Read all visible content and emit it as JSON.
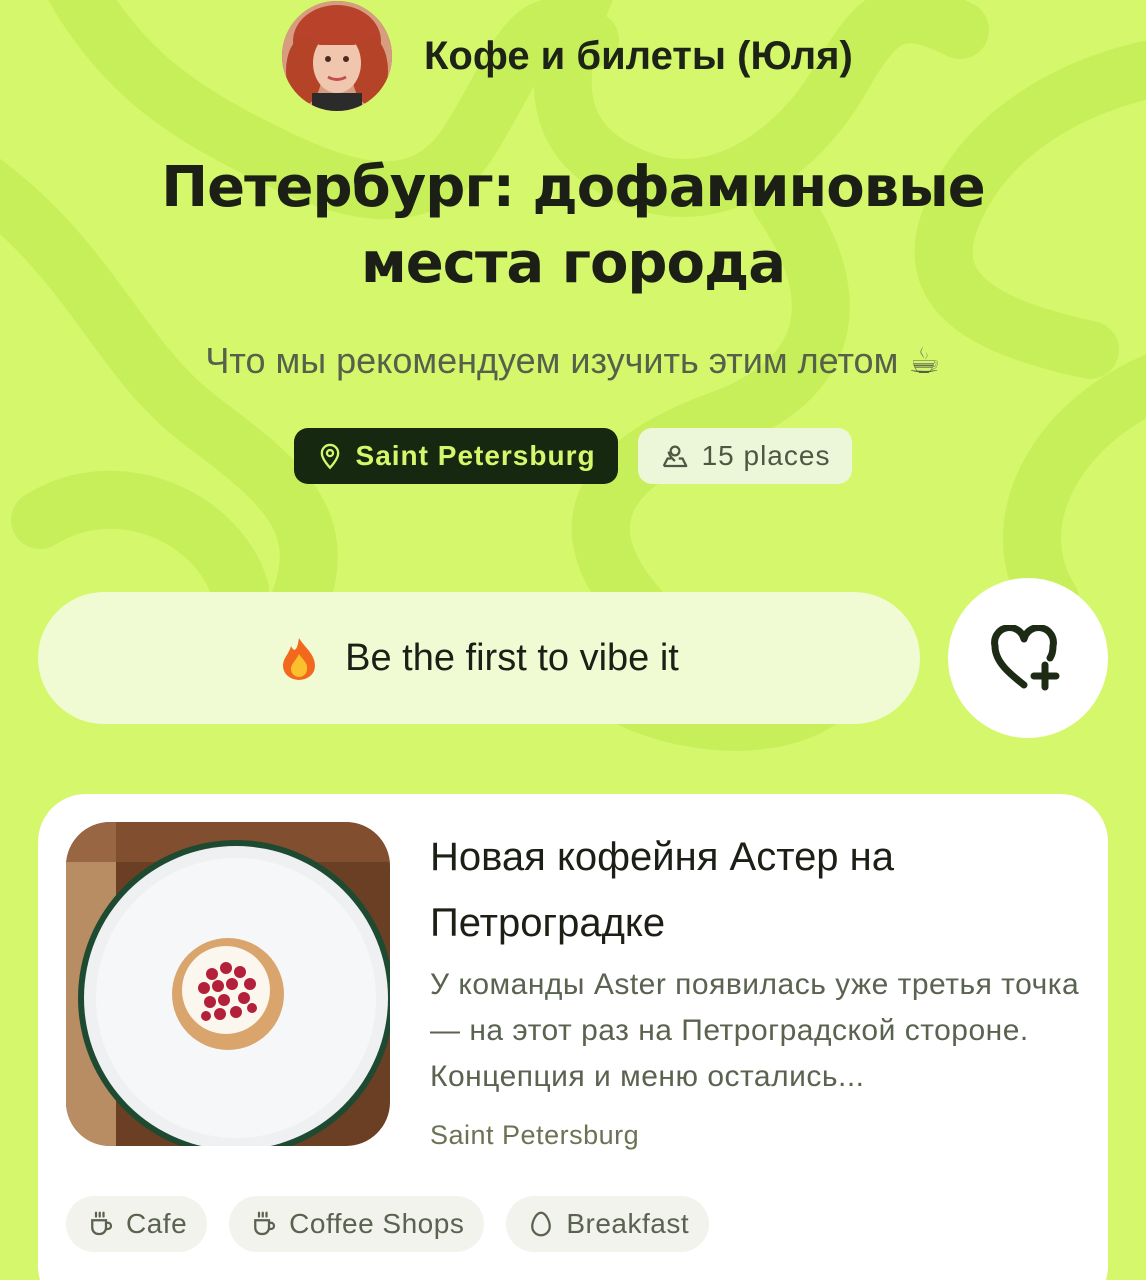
{
  "author": {
    "name": "Кофе и билеты (Юля)",
    "avatar_icon": "avatar-photo"
  },
  "page": {
    "title_line1": "Петербург: дофаминовые",
    "title_line2": "места города",
    "subtitle": "Что мы рекомендуем изучить этим летом ☕"
  },
  "chips": {
    "city": "Saint Petersburg",
    "city_icon": "location-pin-icon",
    "places": "15 places",
    "places_icon": "map-person-icon"
  },
  "vibe": {
    "label": "Be the first to vibe it",
    "emoji": "fire-icon",
    "fav_icon": "heart-plus-icon"
  },
  "card": {
    "title": "Новая кофейня Астер на Петроградке",
    "description": "У команды Aster появилась уже третья точка — на этот раз на Петроградской стороне. Концепция и меню остались...",
    "city": "Saint Petersburg",
    "tags": [
      {
        "label": "Cafe",
        "icon": "cup-icon"
      },
      {
        "label": "Coffee Shops",
        "icon": "cup-icon"
      },
      {
        "label": "Breakfast",
        "icon": "egg-icon"
      }
    ]
  },
  "colors": {
    "background": "#d5f76b",
    "accent_dark": "#162810",
    "card": "#ffffff"
  }
}
